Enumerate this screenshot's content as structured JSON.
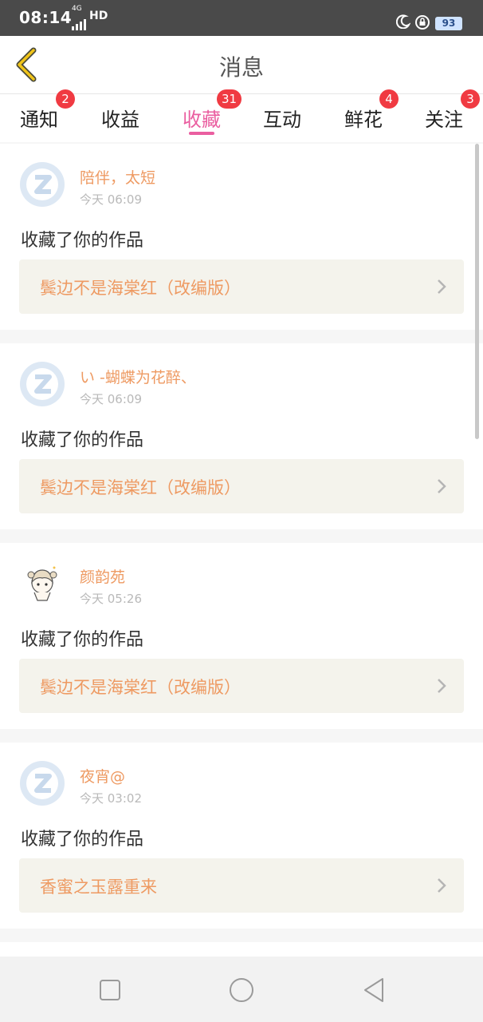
{
  "status_bar": {
    "time": "08:14",
    "network": "4G",
    "hd": "HD",
    "battery": "93",
    "icons": [
      "signal-icon",
      "moon-icon",
      "lock-rotation-icon",
      "battery-icon"
    ]
  },
  "header": {
    "title": "消息",
    "back_icon": "chevron-left-icon"
  },
  "tabs": [
    {
      "label": "通知",
      "badge": "2"
    },
    {
      "label": "收益",
      "badge": ""
    },
    {
      "label": "收藏",
      "badge": "31",
      "active": true
    },
    {
      "label": "互动",
      "badge": ""
    },
    {
      "label": "鲜花",
      "badge": "4"
    },
    {
      "label": "关注",
      "badge": "3"
    }
  ],
  "items": [
    {
      "user": "陪伴，太短",
      "time": "今天 06:09",
      "action": "收藏了你的作品",
      "work": "鬓边不是海棠红（改编版）",
      "avatar": "default-z-avatar"
    },
    {
      "user": "い -蝴蝶为花醉、",
      "time": "今天 06:09",
      "action": "收藏了你的作品",
      "work": "鬓边不是海棠红（改编版）",
      "avatar": "default-z-avatar"
    },
    {
      "user": "颜韵苑",
      "time": "今天 05:26",
      "action": "收藏了你的作品",
      "work": "鬓边不是海棠红（改编版）",
      "avatar": "cartoon-girl-avatar"
    },
    {
      "user": "夜宵@",
      "time": "今天 03:02",
      "action": "收藏了你的作品",
      "work": "香蜜之玉露重来",
      "avatar": "default-z-avatar"
    }
  ],
  "colors": {
    "accent": "#ea5ea0",
    "name_orange": "#ee9a62",
    "badge_red": "#f03a42",
    "work_bg": "#f4f3ec",
    "back_yellow": "#f0c419"
  },
  "nav_bar": {
    "buttons": [
      "recent-apps-icon",
      "home-icon",
      "back-icon"
    ]
  }
}
